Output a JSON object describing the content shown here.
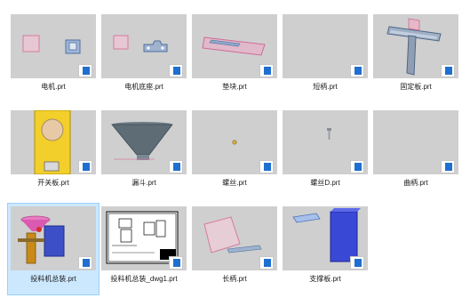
{
  "files": [
    {
      "name": "电机.prt",
      "icon": "part-file-icon"
    },
    {
      "name": "电机底座.prt",
      "icon": "part-file-icon"
    },
    {
      "name": "垫块.prt",
      "icon": "part-file-icon"
    },
    {
      "name": "短柄.prt",
      "icon": "part-file-icon"
    },
    {
      "name": "固定板.prt",
      "icon": "part-file-icon"
    },
    {
      "name": "开关板.prt",
      "icon": "part-file-icon"
    },
    {
      "name": "漏斗.prt",
      "icon": "part-file-icon"
    },
    {
      "name": "螺丝.prt",
      "icon": "part-file-icon"
    },
    {
      "name": "螺丝D.prt",
      "icon": "part-file-icon"
    },
    {
      "name": "曲柄.prt",
      "icon": "part-file-icon"
    },
    {
      "name": "投料机总装.prt",
      "icon": "part-file-icon",
      "selected": true
    },
    {
      "name": "投料机总装_dwg1.prt",
      "icon": "part-file-icon"
    },
    {
      "name": "长柄.prt",
      "icon": "part-file-icon"
    },
    {
      "name": "支撑板.prt",
      "icon": "part-file-icon"
    }
  ],
  "colors": {
    "thumb_bg": "#cfcfd0",
    "selection": "#cce8ff",
    "badge_blue": "#1f6fd1"
  }
}
